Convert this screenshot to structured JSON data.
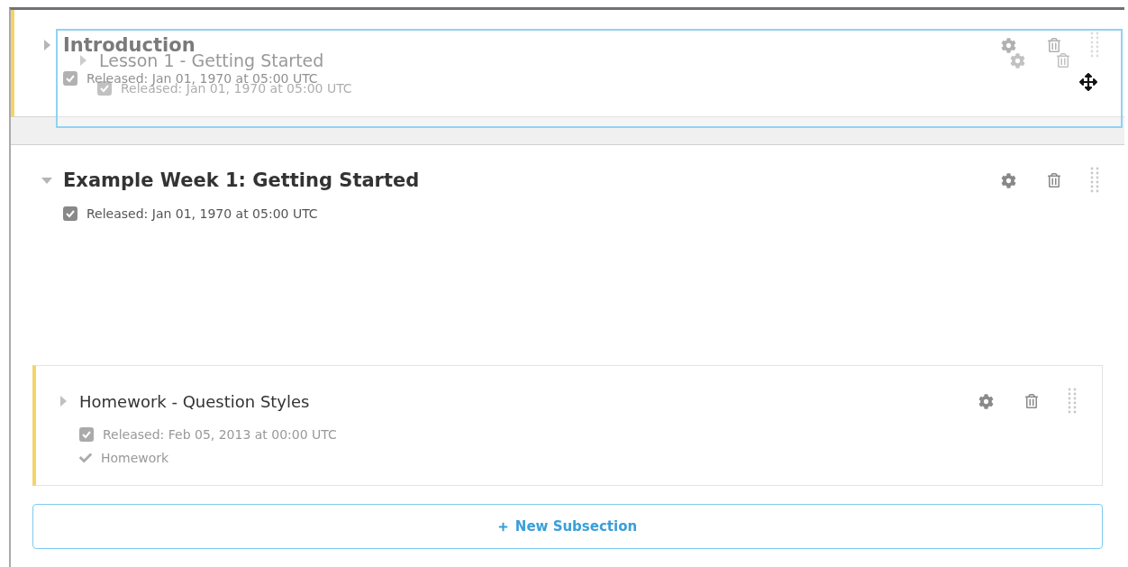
{
  "sections": [
    {
      "title": "Introduction",
      "expanded": false,
      "release_checked": true,
      "released": "Released: Jan 01, 1970 at 05:00 UTC"
    },
    {
      "title": "Example Week 1: Getting Started",
      "expanded": true,
      "release_checked": true,
      "released": "Released: Jan 01, 1970 at 05:00 UTC",
      "subsections": [
        {
          "title": "Homework - Question Styles",
          "expanded": false,
          "release_checked": true,
          "released": "Released: Feb 05, 2013 at 00:00 UTC",
          "graded": "Homework"
        }
      ],
      "new_subsection_button": {
        "label": "New Subsection"
      }
    }
  ],
  "dragging": {
    "title": "Lesson 1 - Getting Started",
    "expanded": false,
    "release_checked": true,
    "released": "Released: Jan 01, 1970 at 05:00 UTC"
  }
}
